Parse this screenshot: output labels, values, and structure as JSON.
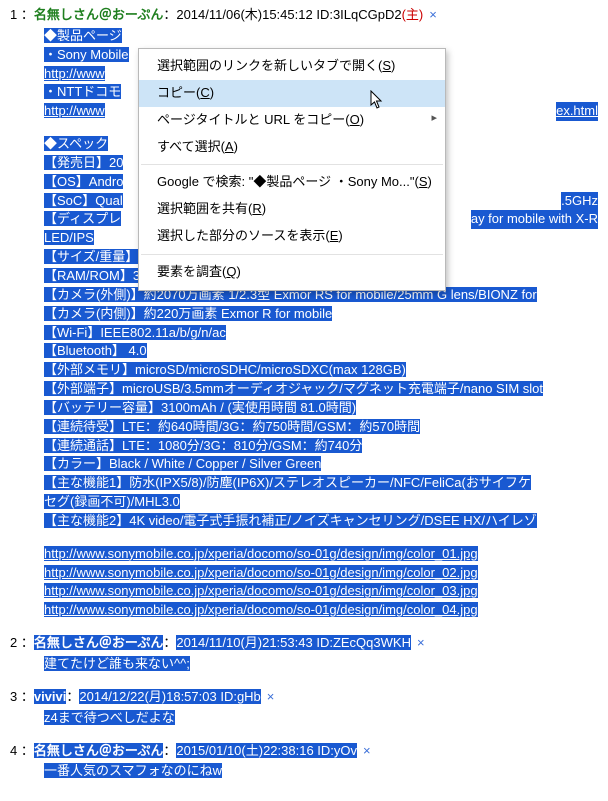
{
  "context_menu": {
    "items": [
      {
        "label": "選択範囲のリンクを新しいタブで開く",
        "accel": "S",
        "type": "item"
      },
      {
        "label": "コピー",
        "accel": "C",
        "type": "item",
        "hover": true
      },
      {
        "label": "ページタイトルと URL をコピー",
        "accel": "O",
        "type": "item",
        "sub": true
      },
      {
        "label": "すべて選択",
        "accel": "A",
        "type": "item"
      },
      {
        "type": "sep"
      },
      {
        "label": "Google で検索: \"◆製品ページ ・Sony Mo...\"",
        "accel": "S",
        "type": "item"
      },
      {
        "label": "選択範囲を共有",
        "accel": "R",
        "type": "item"
      },
      {
        "label": "選択した部分のソースを表示",
        "accel": "E",
        "type": "item"
      },
      {
        "type": "sep"
      },
      {
        "label": "要素を調査",
        "accel": "Q",
        "type": "item"
      }
    ]
  },
  "posts": [
    {
      "num": "1",
      "name": "名無しさん＠おーぷん",
      "date": "2014/11/06(木)15:45:12",
      "id": "ID:3ILqCGpD2",
      "mark": "(主)",
      "x": "×",
      "head_selected": false,
      "body": [
        {
          "t": "◆製品ページ",
          "sel": true
        },
        {
          "t": "・Sony Mobile",
          "sel": true,
          "head": true
        },
        {
          "t": "http://www",
          "sel": true,
          "link": true,
          "head": true
        },
        {
          "t": "・NTTドコモ",
          "sel": true,
          "head": true
        },
        {
          "t": "http://www",
          "sel": true,
          "link": true,
          "head": true,
          "tail": "ex.html"
        },
        {
          "blank": true
        },
        {
          "t": "◆スペック",
          "sel": true,
          "head": true
        },
        {
          "t": "【発売日】20",
          "sel": true,
          "head": true
        },
        {
          "t": "【OS】Andro",
          "sel": true,
          "head": true
        },
        {
          "t": "【SoC】Qual",
          "sel": true,
          "head": true,
          "tail": ".5GHz"
        },
        {
          "t": "【ディスプレ",
          "sel": true,
          "head": true,
          "tail": "ay for mobile with X-R"
        },
        {
          "t": "LED/IPS",
          "sel": true,
          "head": true
        },
        {
          "t": "【サイズ/重量】146 × 72 × 7.3mm/152g",
          "sel": true
        },
        {
          "t": "【RAM/ROM】3GB / 32GB",
          "sel": true
        },
        {
          "t": "【カメラ(外側)】約2070万画素 1/2.3型 Exmor RS for mobile/25mm G lens/BIONZ for",
          "sel": true
        },
        {
          "t": "【カメラ(内側)】約220万画素 Exmor R for mobile",
          "sel": true
        },
        {
          "t": "【Wi-Fi】IEEE802.11a/b/g/n/ac",
          "sel": true
        },
        {
          "t": "【Bluetooth】 4.0",
          "sel": true
        },
        {
          "t": "【外部メモリ】microSD/microSDHC/microSDXC(max 128GB)",
          "sel": true
        },
        {
          "t": "【外部端子】microUSB/3.5mmオーディオジャック/マグネット充電端子/nano SIM slot",
          "sel": true
        },
        {
          "t": "【バッテリー容量】3100mAh / (実使用時間 81.0時間)",
          "sel": true
        },
        {
          "t": "【連続待受】LTE：約640時間/3G：約750時間/GSM：約570時間",
          "sel": true
        },
        {
          "t": "【連続通話】LTE：1080分/3G：810分/GSM：約740分",
          "sel": true
        },
        {
          "t": "【カラー】Black / White / Copper / Silver Green",
          "sel": true
        },
        {
          "t": "【主な機能1】防水(IPX5/8)/防塵(IP6X)/ステレオスピーカー/NFC/FeliCa(おサイフケ",
          "sel": true
        },
        {
          "t": "セグ(録画不可)/MHL3.0",
          "sel": true
        },
        {
          "t": "【主な機能2】4K video/電子式手振れ補正/ノイズキャンセリング/DSEE HX/ハイレゾ",
          "sel": true
        },
        {
          "blank": true
        },
        {
          "t": "http://www.sonymobile.co.jp/xperia/docomo/so-01g/design/img/color_01.jpg",
          "sel": true,
          "link": true
        },
        {
          "t": "http://www.sonymobile.co.jp/xperia/docomo/so-01g/design/img/color_02.jpg",
          "sel": true,
          "link": true
        },
        {
          "t": "http://www.sonymobile.co.jp/xperia/docomo/so-01g/design/img/color_03.jpg",
          "sel": true,
          "link": true
        },
        {
          "t": "http://www.sonymobile.co.jp/xperia/docomo/so-01g/design/img/color_04.jpg",
          "sel": true,
          "link": true
        }
      ]
    },
    {
      "num": "2",
      "name": "名無しさん＠おーぷん",
      "date": "2014/11/10(月)21:53:43",
      "id": "ID:ZEcQq3WKH",
      "x": "×",
      "head_selected": true,
      "body": [
        {
          "t": "建てたけど誰も来ない^^;",
          "sel": true
        }
      ]
    },
    {
      "num": "3",
      "name": "vivivi",
      "date": "2014/12/22(月)18:57:03",
      "id": "ID:gHb",
      "x": "×",
      "head_selected": true,
      "body": [
        {
          "t": "z4まで待つべしだよな",
          "sel": true
        }
      ]
    },
    {
      "num": "4",
      "name": "名無しさん＠おーぷん",
      "date": "2015/01/10(土)22:38:16",
      "id": "ID:yOv",
      "x": "×",
      "head_selected": true,
      "body": [
        {
          "t": "一番人気のスマフォなのにねw",
          "sel": true
        }
      ]
    }
  ]
}
